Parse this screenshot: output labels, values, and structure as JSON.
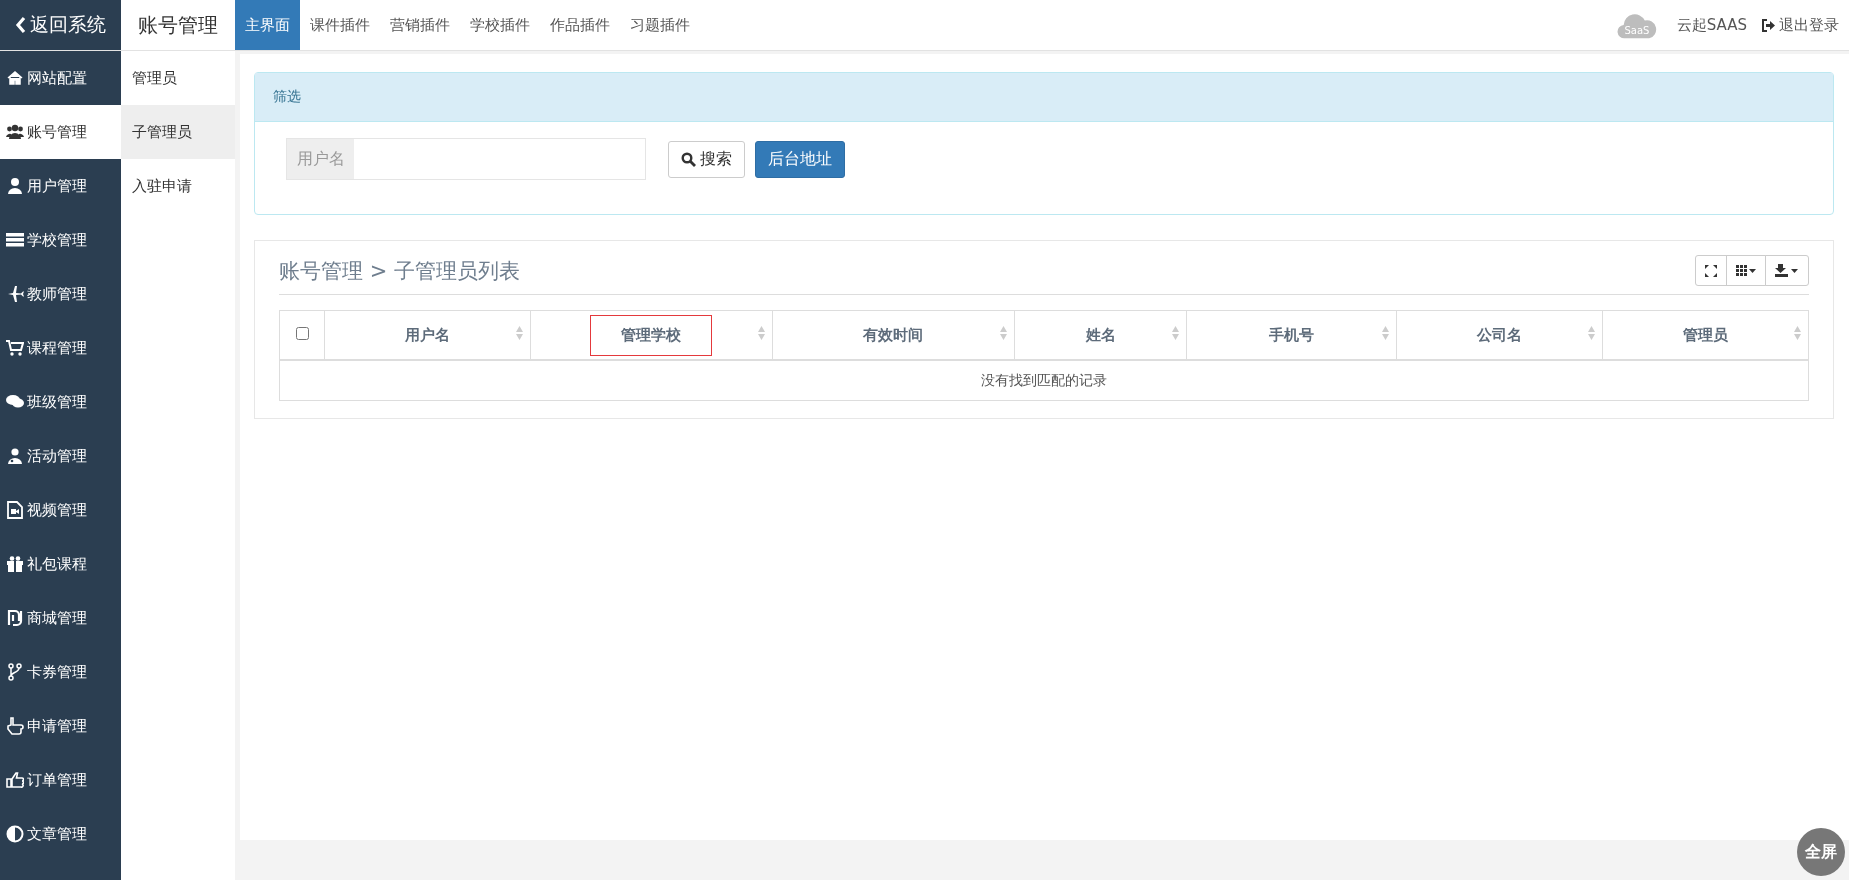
{
  "back_button": "返回系统",
  "section_title": "账号管理",
  "tabs": [
    {
      "label": "主界面",
      "selected": true
    },
    {
      "label": "课件插件",
      "selected": false
    },
    {
      "label": "营销插件",
      "selected": false
    },
    {
      "label": "学校插件",
      "selected": false
    },
    {
      "label": "作品插件",
      "selected": false
    },
    {
      "label": "习题插件",
      "selected": false
    }
  ],
  "logo_text": "SaaS",
  "brand": "云起SAAS",
  "logout": "退出登录",
  "sidebar": {
    "items": [
      {
        "label": "网站配置",
        "selected": false
      },
      {
        "label": "账号管理",
        "selected": true
      },
      {
        "label": "用户管理",
        "selected": false
      },
      {
        "label": "学校管理",
        "selected": false
      },
      {
        "label": "教师管理",
        "selected": false
      },
      {
        "label": "课程管理",
        "selected": false
      },
      {
        "label": "班级管理",
        "selected": false
      },
      {
        "label": "活动管理",
        "selected": false
      },
      {
        "label": "视频管理",
        "selected": false
      },
      {
        "label": "礼包课程",
        "selected": false
      },
      {
        "label": "商城管理",
        "selected": false
      },
      {
        "label": "卡券管理",
        "selected": false
      },
      {
        "label": "申请管理",
        "selected": false
      },
      {
        "label": "订单管理",
        "selected": false
      },
      {
        "label": "文章管理",
        "selected": false
      }
    ]
  },
  "subnav": {
    "items": [
      {
        "label": "管理员",
        "selected": false
      },
      {
        "label": "子管理员",
        "selected": true
      },
      {
        "label": "入驻申请",
        "selected": false
      }
    ]
  },
  "filter": {
    "title": "筛选",
    "field_label": "用户名",
    "search_button": "搜索",
    "backend_button": "后台地址"
  },
  "table_panel": {
    "breadcrumb": "账号管理 > 子管理员列表",
    "select_all_checked": false,
    "columns": [
      {
        "label": "用户名",
        "highlighted": false
      },
      {
        "label": "管理学校",
        "highlighted": true
      },
      {
        "label": "有效时间",
        "highlighted": false
      },
      {
        "label": "姓名",
        "highlighted": false
      },
      {
        "label": "手机号",
        "highlighted": false
      },
      {
        "label": "公司名",
        "highlighted": false
      },
      {
        "label": "管理员",
        "highlighted": false
      }
    ],
    "empty_message": "没有找到匹配的记录"
  },
  "fullscreen_button": "全屏"
}
